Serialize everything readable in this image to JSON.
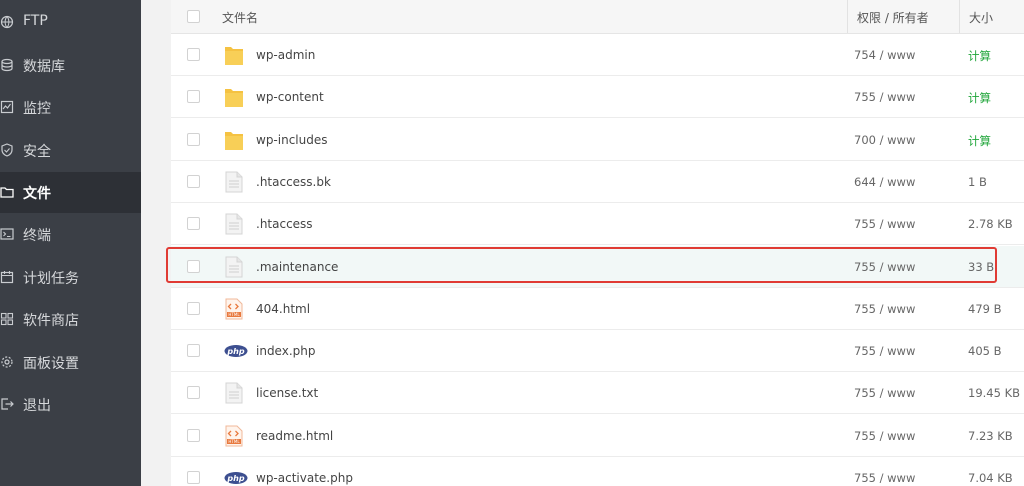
{
  "sidebar": {
    "items": [
      {
        "label": "FTP",
        "icon": "globe-icon"
      },
      {
        "label": "数据库",
        "icon": "database-icon"
      },
      {
        "label": "监控",
        "icon": "monitor-icon"
      },
      {
        "label": "安全",
        "icon": "shield-icon"
      },
      {
        "label": "文件",
        "icon": "folder-icon",
        "active": true
      },
      {
        "label": "终端",
        "icon": "terminal-icon"
      },
      {
        "label": "计划任务",
        "icon": "calendar-icon"
      },
      {
        "label": "软件商店",
        "icon": "grid-icon"
      },
      {
        "label": "面板设置",
        "icon": "gear-icon"
      },
      {
        "label": "退出",
        "icon": "logout-icon"
      }
    ]
  },
  "table": {
    "headers": {
      "name": "文件名",
      "perm": "权限 / 所有者",
      "size": "大小"
    },
    "rows": [
      {
        "name": "wp-admin",
        "type": "folder",
        "perm": "754 / www",
        "size": "计算"
      },
      {
        "name": "wp-content",
        "type": "folder",
        "perm": "755 / www",
        "size": "计算"
      },
      {
        "name": "wp-includes",
        "type": "folder",
        "perm": "700 / www",
        "size": "计算"
      },
      {
        "name": ".htaccess.bk",
        "type": "file",
        "perm": "644 / www",
        "size": "1 B"
      },
      {
        "name": ".htaccess",
        "type": "file",
        "perm": "755 / www",
        "size": "2.78 KB"
      },
      {
        "name": ".maintenance",
        "type": "file",
        "perm": "755 / www",
        "size": "33 B",
        "highlighted": true
      },
      {
        "name": "404.html",
        "type": "html",
        "perm": "755 / www",
        "size": "479 B"
      },
      {
        "name": "index.php",
        "type": "php",
        "perm": "755 / www",
        "size": "405 B"
      },
      {
        "name": "license.txt",
        "type": "file",
        "perm": "755 / www",
        "size": "19.45 KB"
      },
      {
        "name": "readme.html",
        "type": "html",
        "perm": "755 / www",
        "size": "7.23 KB"
      },
      {
        "name": "wp-activate.php",
        "type": "php",
        "perm": "755 / www",
        "size": "7.04 KB"
      }
    ]
  },
  "colors": {
    "accent_green": "#20a53a",
    "highlight_red": "#e03b34",
    "sidebar_bg": "#3b3f46"
  }
}
